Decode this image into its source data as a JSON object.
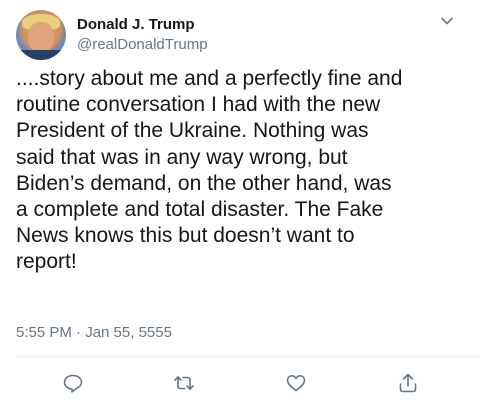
{
  "tweet": {
    "display_name": "Donald J. Trump",
    "handle": "@realDonaldTrump",
    "text": "....story about me and a perfectly fine and\nroutine conversation I had with the new\nPresident of the Ukraine. Nothing was\nsaid that was in any way wrong, but\nBiden’s demand, on the other hand, was\na complete and total disaster. The Fake\nNews knows this but doesn’t want to\nreport!",
    "timestamp": "5:55 PM · Jan 55, 5555"
  },
  "icons": {
    "menu": "chevron-down-icon",
    "reply": "reply-icon",
    "retweet": "retweet-icon",
    "like": "heart-icon",
    "share": "share-icon"
  },
  "colors": {
    "text": "#14171a",
    "secondary": "#657786",
    "icon": "#657786",
    "divider": "#e6ecf0"
  }
}
